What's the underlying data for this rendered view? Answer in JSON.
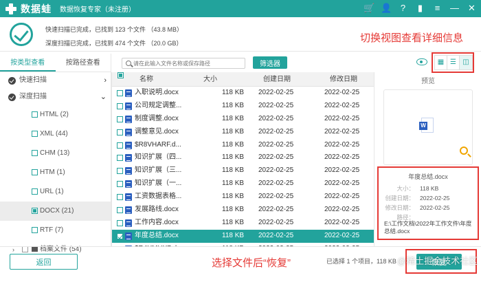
{
  "app": {
    "name": "数据蛙",
    "subtitle": "数据恢复专家（未注册）"
  },
  "summary": {
    "quick_scan": "快速扫描已完成，已找到 123 个文件 （43.8 MB）",
    "deep_scan": "深度扫描已完成，已找到 474 个文件 （20.0 GB）"
  },
  "annotations": {
    "top": "切换视图查看详细信息",
    "bottom": "选择文件后“恢复”"
  },
  "left_panel": {
    "tabs": [
      "按类型查看",
      "按路径查看"
    ],
    "scan_items": [
      "快速扫描",
      "深度扫描"
    ],
    "types": [
      "HTML (2)",
      "XML (44)",
      "CHM (13)",
      "HTM (1)",
      "URL (1)",
      "DOCX (21)",
      "RTF (7)"
    ],
    "archive": "档案文件 (54)"
  },
  "toolbar": {
    "search_placeholder": "请在此输入文件名称或保存路径",
    "filter_button": "筛选器"
  },
  "table": {
    "headers": [
      "名称",
      "大小",
      "创建日期",
      "修改日期"
    ],
    "rows": [
      {
        "name": "入职说明.docx",
        "size": "118 KB",
        "created": "2022-02-25",
        "modified": "2022-02-25"
      },
      {
        "name": "公司规定调整...",
        "size": "118 KB",
        "created": "2022-02-25",
        "modified": "2022-02-25"
      },
      {
        "name": "制度调整.docx",
        "size": "118 KB",
        "created": "2022-02-25",
        "modified": "2022-02-25"
      },
      {
        "name": "调整意见.docx",
        "size": "118 KB",
        "created": "2022-02-25",
        "modified": "2022-02-25"
      },
      {
        "name": "$R8VHARF.d...",
        "size": "118 KB",
        "created": "2022-02-25",
        "modified": "2022-02-25"
      },
      {
        "name": "知识扩展（四...",
        "size": "118 KB",
        "created": "2022-02-25",
        "modified": "2022-02-25"
      },
      {
        "name": "知识扩展（三...",
        "size": "118 KB",
        "created": "2022-02-25",
        "modified": "2022-02-25"
      },
      {
        "name": "知识扩展（一...",
        "size": "118 KB",
        "created": "2022-02-25",
        "modified": "2022-02-25"
      },
      {
        "name": "工资数据表格...",
        "size": "118 KB",
        "created": "2022-02-25",
        "modified": "2022-02-25"
      },
      {
        "name": "发展路线.docx",
        "size": "118 KB",
        "created": "2022-02-25",
        "modified": "2022-02-25"
      },
      {
        "name": "工作内容.docx",
        "size": "118 KB",
        "created": "2022-02-25",
        "modified": "2022-02-25"
      },
      {
        "name": "年度总结.docx",
        "size": "118 KB",
        "created": "2022-02-25",
        "modified": "2022-02-25"
      },
      {
        "name": "$R4YMUX7.d...",
        "size": "118 KB",
        "created": "2022-02-25",
        "modified": "2022-02-25"
      },
      {
        "name": "毕业论文.docx",
        "size": "118 KB",
        "created": "2022-02-25",
        "modified": "2022-02-25"
      }
    ]
  },
  "preview": {
    "title": "预览",
    "file_name": "年度总结.docx",
    "size_label": "大小：",
    "size": "118 KB",
    "created_label": "创建日期：",
    "created": "2022-02-25",
    "modified_label": "修改日期：",
    "modified": "2022-02-25",
    "path_label": "路径：",
    "path": "E:\\工作文档\\2022年工作文件\\年度总结.docx"
  },
  "footer": {
    "back_button": "返回",
    "status": "已选择 1 个项目，118 KB",
    "recover_button": "恢复",
    "watermark": "@稀土掘金技术社区"
  },
  "colors": {
    "brand": "#22a39c",
    "annotation": "#e53935"
  }
}
